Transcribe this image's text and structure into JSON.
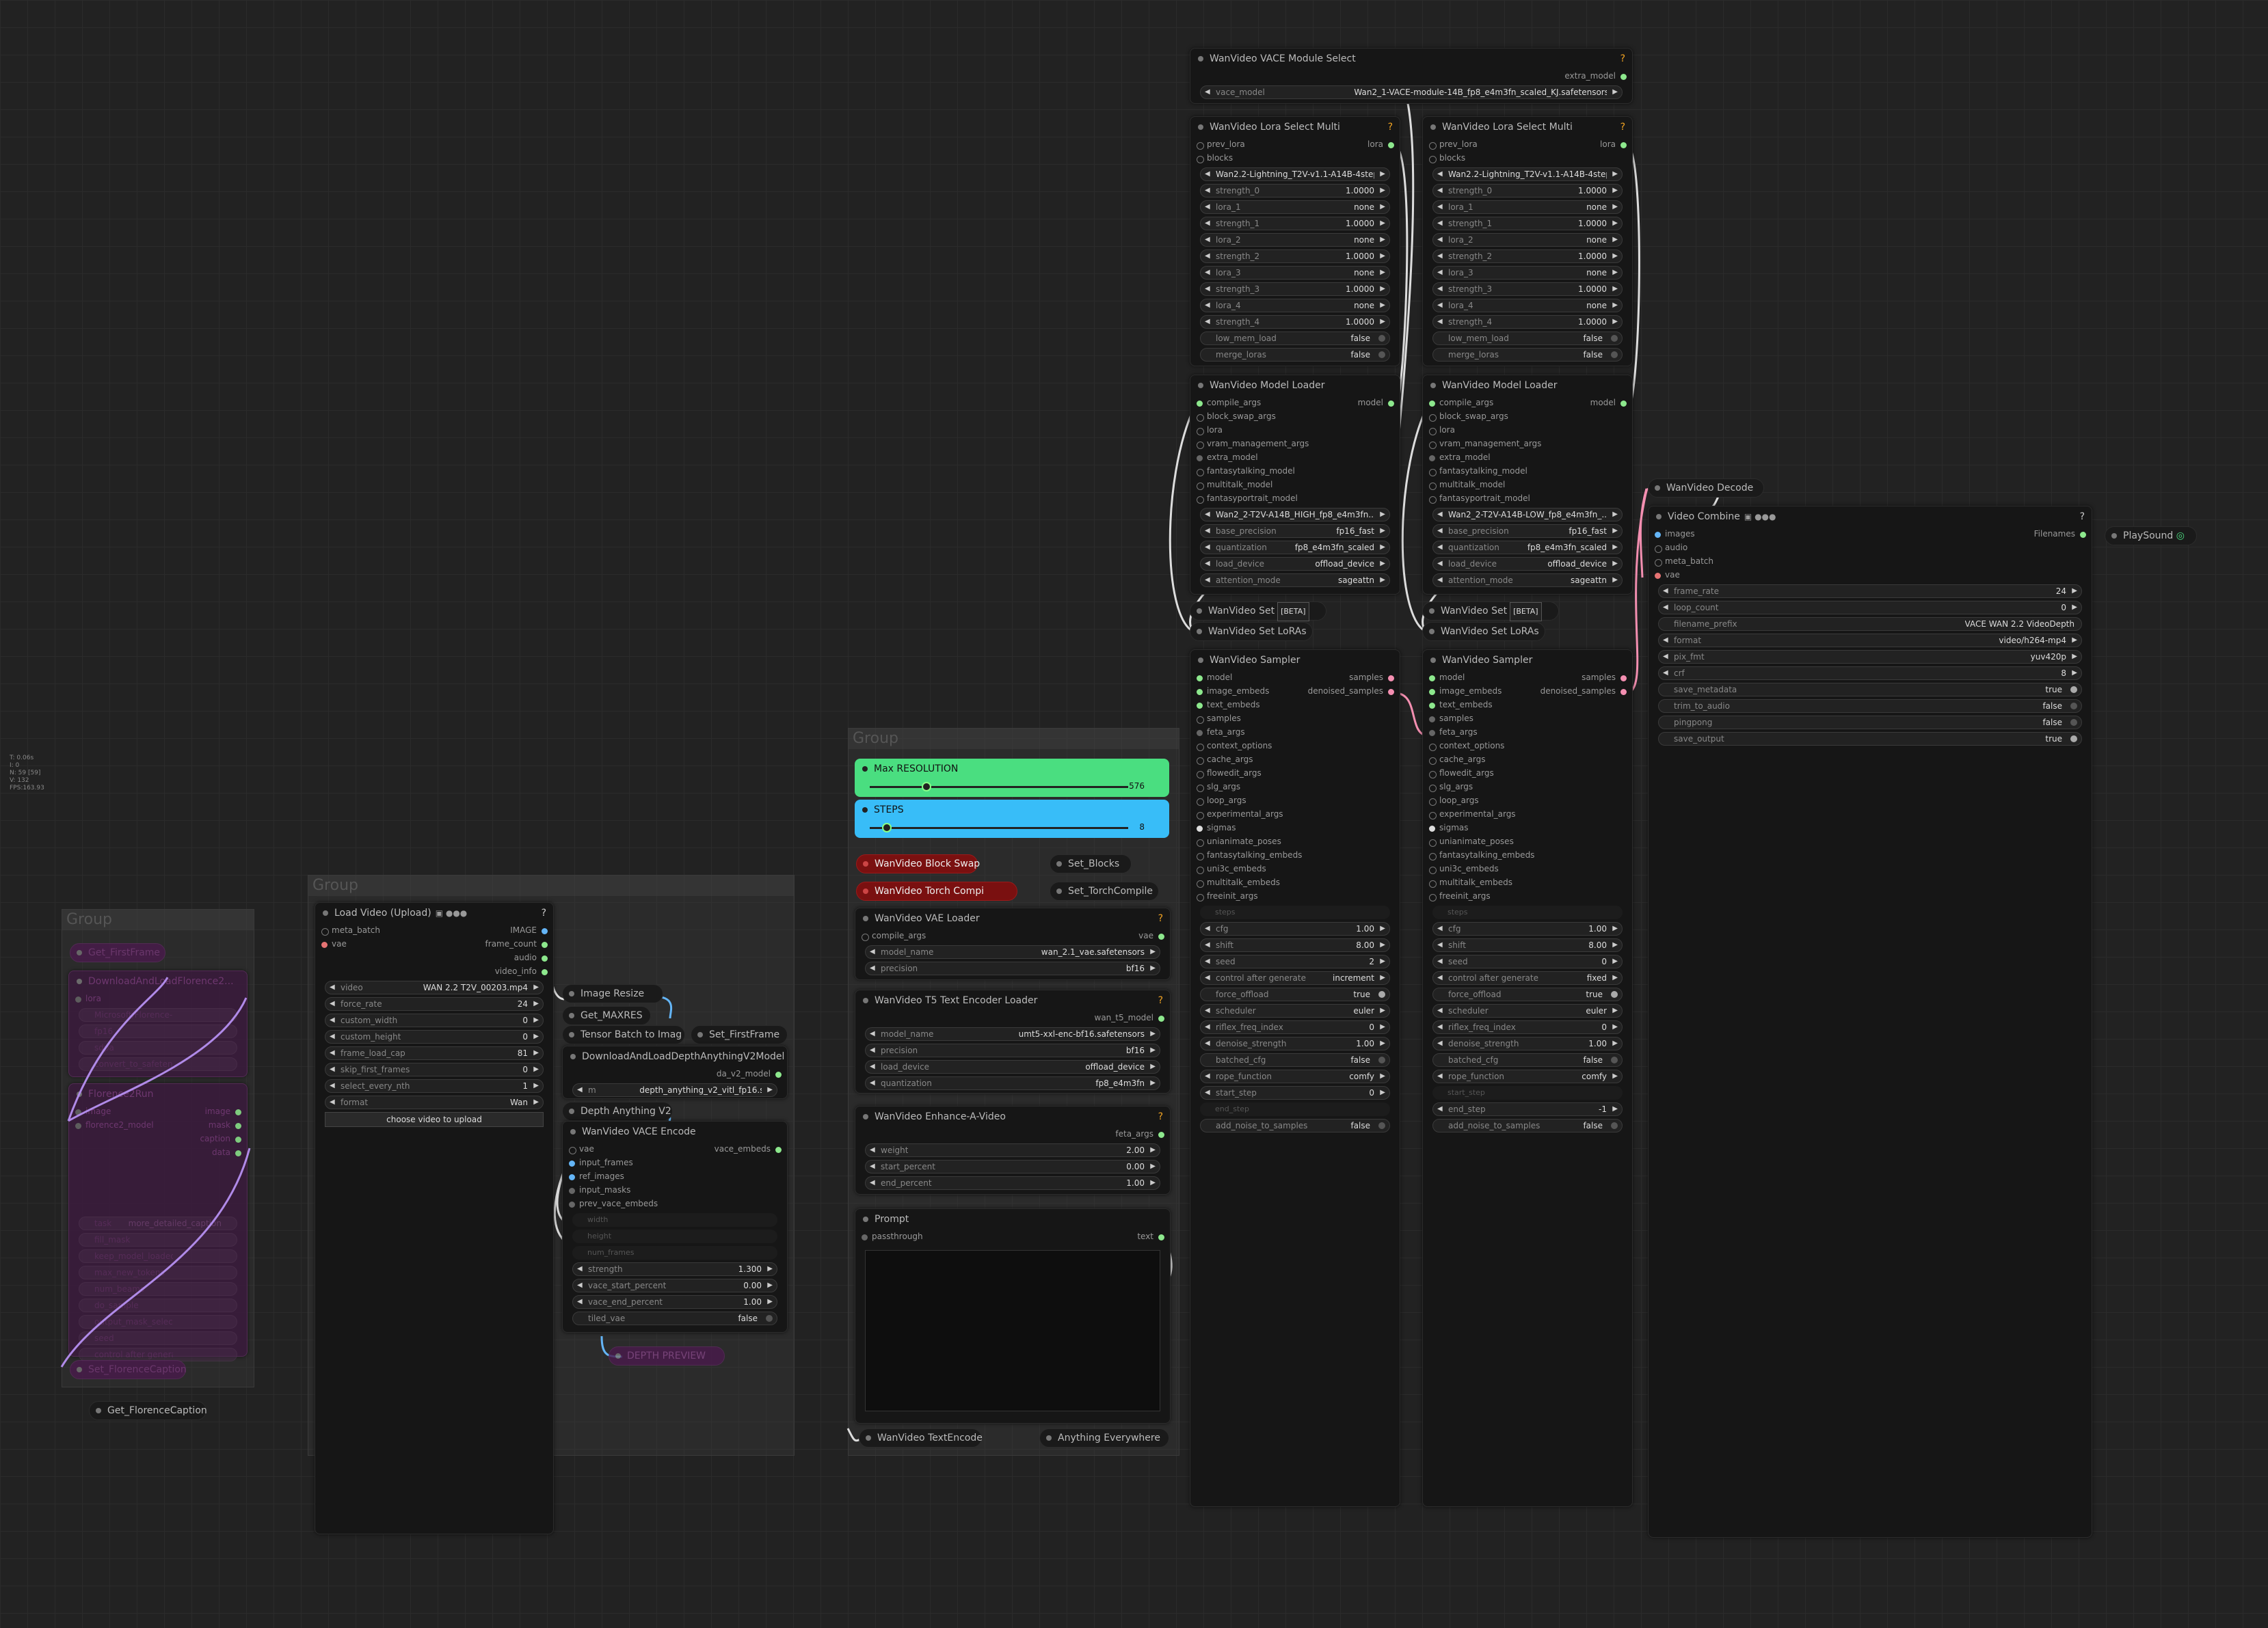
{
  "stats": [
    "T: 0.06s",
    "I: 0",
    "N: 59 [59]",
    "V: 132",
    "FPS:163.93"
  ],
  "groups": {
    "g1": "Group",
    "g2": "Group",
    "g3": "Group"
  },
  "florence_faded": {
    "get_first_frame": "Get_FirstFrame",
    "download_title": "DownloadAndLoadFlorence2...",
    "download_rows": [
      "lora",
      "Florence-2-base",
      "Microsoft/Florence-2-large",
      "fp16",
      "sdpa",
      "convert_to_safetensors"
    ],
    "run_title": "Florence2Run",
    "run_rows": [
      "image",
      "florence2_model",
      "caption",
      "mask",
      "data",
      "task",
      "more_detailed_caption",
      "fill_mask",
      "keep_model_loaded",
      "max_new_tokens",
      "num_beams",
      "do_sample",
      "output_mask_select",
      "seed",
      "control after generate"
    ],
    "set_caption": "Set_FlorenceCaption"
  },
  "get_florence_caption": "Get_FlorenceCaption",
  "load_video": {
    "title": "Load Video (Upload)",
    "inputs": [
      "meta_batch",
      "vae"
    ],
    "outputs": [
      "IMAGE",
      "frame_count",
      "audio",
      "video_info"
    ],
    "widgets": [
      {
        "k": "video",
        "v": "WAN 2.2 T2V_00203.mp4"
      },
      {
        "k": "force_rate",
        "v": "24"
      },
      {
        "k": "custom_width",
        "v": "0"
      },
      {
        "k": "custom_height",
        "v": "0"
      },
      {
        "k": "frame_load_cap",
        "v": "81"
      },
      {
        "k": "skip_first_frames",
        "v": "0"
      },
      {
        "k": "select_every_nth",
        "v": "1"
      },
      {
        "k": "format",
        "v": "Wan"
      }
    ],
    "button": "choose video to upload"
  },
  "image_resize": "Image Resize",
  "get_maxres": "Get_MAXRES",
  "tensor_batch": "Tensor Batch to Imag",
  "set_firstframe": "Set_FirstFrame",
  "depth_loader": {
    "title": "DownloadAndLoadDepthAnythingV2Model",
    "output": "da_v2_model",
    "widget_k": "m",
    "widget_v": "depth_anything_v2_vitl_fp16.safetensors"
  },
  "depth_anything": "Depth Anything V2",
  "vace_encode": {
    "title": "WanVideo VACE Encode",
    "output": "vace_embeds",
    "inputs": [
      "vae",
      "input_frames",
      "ref_images",
      "input_masks",
      "prev_vace_embeds"
    ],
    "disabled": [
      "width",
      "height",
      "num_frames"
    ],
    "widgets": [
      {
        "k": "strength",
        "v": "1.300"
      },
      {
        "k": "vace_start_percent",
        "v": "0.00"
      },
      {
        "k": "vace_end_percent",
        "v": "1.00"
      }
    ],
    "toggle": {
      "k": "tiled_vae",
      "v": "false"
    }
  },
  "depth_preview": "DEPTH PREVIEW",
  "max_res": {
    "title": "Max RESOLUTION",
    "value": "576"
  },
  "steps": {
    "title": "STEPS",
    "value": "8"
  },
  "block_swap": "WanVideo Block Swap",
  "set_blocks": "Set_Blocks",
  "torch_compile": "WanVideo Torch Compi",
  "set_torchcompile": "Set_TorchCompile",
  "vae_loader": {
    "title": "WanVideo VAE Loader",
    "input": "compile_args",
    "output": "vae",
    "widgets": [
      {
        "k": "model_name",
        "v": "wan_2.1_vae.safetensors"
      },
      {
        "k": "precision",
        "v": "bf16"
      }
    ]
  },
  "t5_loader": {
    "title": "WanVideo T5 Text Encoder Loader",
    "output": "wan_t5_model",
    "widgets": [
      {
        "k": "model_name",
        "v": "umt5-xxl-enc-bf16.safetensors"
      },
      {
        "k": "precision",
        "v": "bf16"
      },
      {
        "k": "load_device",
        "v": "offload_device"
      },
      {
        "k": "quantization",
        "v": "fp8_e4m3fn"
      }
    ]
  },
  "enhance": {
    "title": "WanVideo Enhance-A-Video",
    "output": "feta_args",
    "widgets": [
      {
        "k": "weight",
        "v": "2.00"
      },
      {
        "k": "start_percent",
        "v": "0.00"
      },
      {
        "k": "end_percent",
        "v": "1.00"
      }
    ]
  },
  "prompt": {
    "title": "Prompt",
    "input": "passthrough",
    "output": "text"
  },
  "text_encode": "WanVideo TextEncode",
  "anything_everywhere": "Anything Everywhere",
  "vace_module": {
    "title": "WanVideo VACE Module Select",
    "output": "extra_model",
    "widget_k": "vace_model",
    "widget_v": "Wan2_1-VACE-module-14B_fp8_e4m3fn_scaled_KJ.safetensors"
  },
  "lora_a": {
    "title": "WanVideo Lora Select Multi",
    "inputs": [
      "prev_lora",
      "blocks"
    ],
    "output": "lora",
    "widgets": [
      {
        "k": "",
        "v": "Wan2.2-Lightning_T2V-v1.1-A14B-4step..."
      },
      {
        "k": "strength_0",
        "v": "1.0000"
      },
      {
        "k": "lora_1",
        "v": "none"
      },
      {
        "k": "strength_1",
        "v": "1.0000"
      },
      {
        "k": "lora_2",
        "v": "none"
      },
      {
        "k": "strength_2",
        "v": "1.0000"
      },
      {
        "k": "lora_3",
        "v": "none"
      },
      {
        "k": "strength_3",
        "v": "1.0000"
      },
      {
        "k": "lora_4",
        "v": "none"
      },
      {
        "k": "strength_4",
        "v": "1.0000"
      }
    ],
    "toggles": [
      {
        "k": "low_mem_load",
        "v": "false"
      },
      {
        "k": "merge_loras",
        "v": "false"
      }
    ]
  },
  "lora_b": {
    "title": "WanVideo Lora Select Multi",
    "inputs": [
      "prev_lora",
      "blocks"
    ],
    "output": "lora",
    "widgets": [
      {
        "k": "",
        "v": "Wan2.2-Lightning_T2V-v1.1-A14B-4step..."
      },
      {
        "k": "strength_0",
        "v": "1.0000"
      },
      {
        "k": "lora_1",
        "v": "none"
      },
      {
        "k": "strength_1",
        "v": "1.0000"
      },
      {
        "k": "lora_2",
        "v": "none"
      },
      {
        "k": "strength_2",
        "v": "1.0000"
      },
      {
        "k": "lora_3",
        "v": "none"
      },
      {
        "k": "strength_3",
        "v": "1.0000"
      },
      {
        "k": "lora_4",
        "v": "none"
      },
      {
        "k": "strength_4",
        "v": "1.0000"
      }
    ],
    "toggles": [
      {
        "k": "low_mem_load",
        "v": "false"
      },
      {
        "k": "merge_loras",
        "v": "false"
      }
    ]
  },
  "model_a": {
    "title": "WanVideo Model Loader",
    "inputs": [
      "compile_args",
      "block_swap_args",
      "lora",
      "vram_management_args",
      "extra_model",
      "fantasytalking_model",
      "multitalk_model",
      "fantasyportrait_model"
    ],
    "output": "model",
    "widgets": [
      {
        "k": "",
        "v": "Wan2_2-T2V-A14B_HIGH_fp8_e4m3fn..."
      },
      {
        "k": "base_precision",
        "v": "fp16_fast"
      },
      {
        "k": "quantization",
        "v": "fp8_e4m3fn_scaled"
      },
      {
        "k": "load_device",
        "v": "offload_device"
      },
      {
        "k": "attention_mode",
        "v": "sageattn"
      }
    ]
  },
  "model_b": {
    "title": "WanVideo Model Loader",
    "inputs": [
      "compile_args",
      "block_swap_args",
      "lora",
      "vram_management_args",
      "extra_model",
      "fantasytalking_model",
      "multitalk_model",
      "fantasyportrait_model"
    ],
    "output": "model",
    "widgets": [
      {
        "k": "",
        "v": "Wan2_2-T2V-A14B-LOW_fp8_e4m3fn_..."
      },
      {
        "k": "base_precision",
        "v": "fp16_fast"
      },
      {
        "k": "quantization",
        "v": "fp8_e4m3fn_scaled"
      },
      {
        "k": "load_device",
        "v": "offload_device"
      },
      {
        "k": "attention_mode",
        "v": "sageattn"
      }
    ]
  },
  "set_a": {
    "label": "WanVideo Set",
    "beta": "[BETA]"
  },
  "set_loras_a": "WanVideo Set LoRAs",
  "set_b": {
    "label": "WanVideo Set",
    "beta": "[BETA]"
  },
  "set_loras_b": "WanVideo Set LoRAs",
  "sampler_a": {
    "title": "WanVideo Sampler",
    "inputs": [
      "model",
      "image_embeds",
      "text_embeds",
      "samples",
      "feta_args",
      "context_options",
      "cache_args",
      "flowedit_args",
      "slg_args",
      "loop_args",
      "experimental_args",
      "sigmas",
      "unianimate_poses",
      "fantasytalking_embeds",
      "uni3c_embeds",
      "multitalk_embeds",
      "freeinit_args"
    ],
    "outputs": [
      "samples",
      "denoised_samples"
    ],
    "steps": "steps",
    "widgets": [
      {
        "k": "cfg",
        "v": "1.00"
      },
      {
        "k": "shift",
        "v": "8.00"
      },
      {
        "k": "seed",
        "v": "2"
      },
      {
        "k": "control after generate",
        "v": "increment"
      }
    ],
    "force_offload": {
      "k": "force_offload",
      "v": "true"
    },
    "widgets2": [
      {
        "k": "scheduler",
        "v": "euler"
      },
      {
        "k": "riflex_freq_index",
        "v": "0"
      },
      {
        "k": "denoise_strength",
        "v": "1.00"
      }
    ],
    "batched_cfg": {
      "k": "batched_cfg",
      "v": "false"
    },
    "rope": {
      "k": "rope_function",
      "v": "comfy"
    },
    "start_step": {
      "k": "start_step",
      "v": "0"
    },
    "end_step_disabled": "end_step",
    "add_noise": {
      "k": "add_noise_to_samples",
      "v": "false"
    }
  },
  "sampler_b": {
    "title": "WanVideo Sampler",
    "inputs": [
      "model",
      "image_embeds",
      "text_embeds",
      "samples",
      "feta_args",
      "context_options",
      "cache_args",
      "flowedit_args",
      "slg_args",
      "loop_args",
      "experimental_args",
      "sigmas",
      "unianimate_poses",
      "fantasytalking_embeds",
      "uni3c_embeds",
      "multitalk_embeds",
      "freeinit_args"
    ],
    "outputs": [
      "samples",
      "denoised_samples"
    ],
    "steps": "steps",
    "widgets": [
      {
        "k": "cfg",
        "v": "1.00"
      },
      {
        "k": "shift",
        "v": "8.00"
      },
      {
        "k": "seed",
        "v": "0"
      },
      {
        "k": "control after generate",
        "v": "fixed"
      }
    ],
    "force_offload": {
      "k": "force_offload",
      "v": "true"
    },
    "widgets2": [
      {
        "k": "scheduler",
        "v": "euler"
      },
      {
        "k": "riflex_freq_index",
        "v": "0"
      },
      {
        "k": "denoise_strength",
        "v": "1.00"
      }
    ],
    "batched_cfg": {
      "k": "batched_cfg",
      "v": "false"
    },
    "rope": {
      "k": "rope_function",
      "v": "comfy"
    },
    "start_step_disabled": "start_step",
    "end_step": {
      "k": "end_step",
      "v": "-1"
    },
    "add_noise": {
      "k": "add_noise_to_samples",
      "v": "false"
    }
  },
  "decode": "WanVideo Decode",
  "video_combine": {
    "title": "Video Combine",
    "inputs": [
      "images",
      "audio",
      "meta_batch",
      "vae"
    ],
    "output": "Filenames",
    "widgets": [
      {
        "k": "frame_rate",
        "v": "24"
      },
      {
        "k": "loop_count",
        "v": "0"
      }
    ],
    "prefix": {
      "k": "filename_prefix",
      "v": "VACE WAN 2.2 VideoDepth"
    },
    "widgets2": [
      {
        "k": "format",
        "v": "video/h264-mp4"
      },
      {
        "k": "pix_fmt",
        "v": "yuv420p"
      },
      {
        "k": "crf",
        "v": "8"
      }
    ],
    "toggles": [
      {
        "k": "save_metadata",
        "v": "true"
      },
      {
        "k": "trim_to_audio",
        "v": "false"
      },
      {
        "k": "pingpong",
        "v": "false"
      },
      {
        "k": "save_output",
        "v": "true"
      }
    ]
  },
  "playsound": "PlaySound"
}
